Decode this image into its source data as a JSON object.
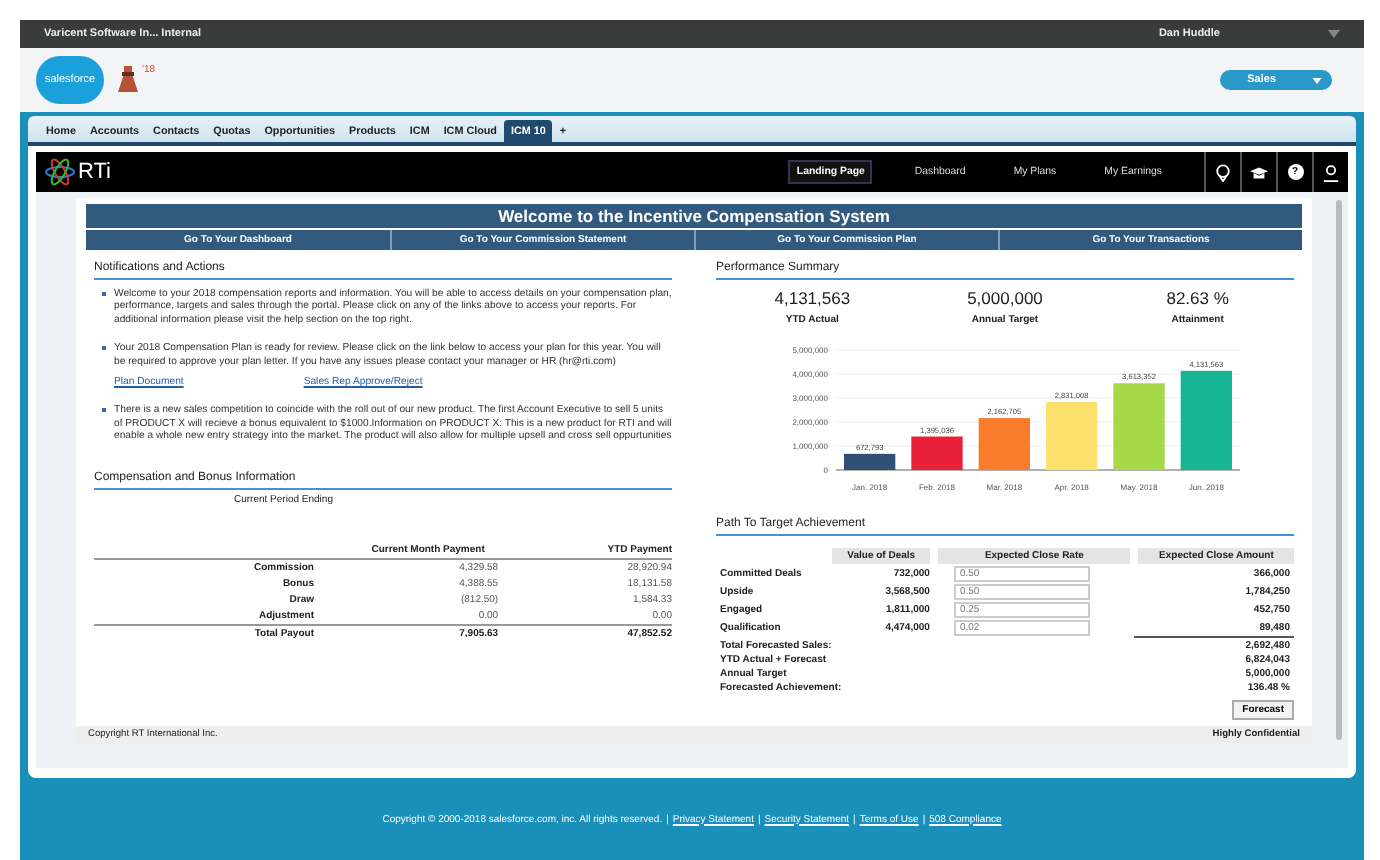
{
  "top_bar": {
    "org": "Varicent Software In... Internal",
    "user": "Dan Huddle"
  },
  "header": {
    "logo": "salesforce",
    "badge": "'18",
    "app_menu": "Sales"
  },
  "tabs": [
    {
      "label": "Home",
      "selected": false
    },
    {
      "label": "Accounts",
      "selected": false
    },
    {
      "label": "Contacts",
      "selected": false
    },
    {
      "label": "Quotas",
      "selected": false
    },
    {
      "label": "Opportunities",
      "selected": false
    },
    {
      "label": "Products",
      "selected": false
    },
    {
      "label": "ICM",
      "selected": false
    },
    {
      "label": "ICM Cloud",
      "selected": false
    },
    {
      "label": "ICM 10",
      "selected": true
    },
    {
      "label": "+",
      "selected": false
    }
  ],
  "app_nav": {
    "logo": "RTi",
    "items": [
      {
        "label": "Landing Page",
        "selected": true
      },
      {
        "label": "Dashboard",
        "selected": false
      },
      {
        "label": "My Plans",
        "selected": false
      },
      {
        "label": "My Earnings",
        "selected": false
      }
    ],
    "help": "?"
  },
  "banner": {
    "title": "Welcome to the Incentive Compensation System",
    "links": [
      "Go To Your Dashboard",
      "Go To Your Commission Statement",
      "Go To Your Commission Plan",
      "Go To Your Transactions"
    ]
  },
  "notifications": {
    "title": "Notifications and Actions",
    "items": [
      {
        "text": "Welcome to your 2018 compensation reports and information. You will be able to access details on your compensation plan, performance, targets and sales through the portal. Please click on any of the links above to access your reports. For additional information please visit the help section on the top right."
      },
      {
        "text": "Your 2018 Compensation Plan is ready for review. Please click on the link below to access your plan for this year. You will be required to approve your plan letter. If you have any issues please contact your manager or HR (hr@rti.com)",
        "links": [
          "Plan Document",
          "Sales Rep Approve/Reject"
        ]
      },
      {
        "text": "There is a new sales competition to coincide with the roll out of our new product. The first Account Executive to sell 5 units of PRODUCT X will recieve a bonus equivalent to $1000.Information on PRODUCT X: This is a new product for RTI and will enable a whole new entry strategy into the market. The product will also allow for multiple upsell and cross sell oppurtunities"
      }
    ]
  },
  "compensation": {
    "title": "Compensation and Bonus Information",
    "subtitle": "Current Period Ending",
    "columns": [
      "Current Month Payment",
      "YTD Payment"
    ],
    "rows": [
      {
        "kind": "line",
        "label": "Commission",
        "current": "4,329.58",
        "ytd": "28,920.94"
      },
      {
        "kind": "line",
        "label": "Bonus",
        "current": "4,388.55",
        "ytd": "18,131.58"
      },
      {
        "kind": "line",
        "label": "Draw",
        "current": "(812.50)",
        "ytd": "1,584.33"
      },
      {
        "kind": "line",
        "label": "Adjustment",
        "current": "0.00",
        "ytd": "0.00"
      },
      {
        "kind": "total",
        "label": "Total Payout",
        "current": "7,905.63",
        "ytd": "47,852.52"
      }
    ]
  },
  "performance": {
    "title": "Performance Summary",
    "kpis": [
      {
        "value": "4,131,563",
        "label": "YTD Actual"
      },
      {
        "value": "5,000,000",
        "label": "Annual Target"
      },
      {
        "value": "82.63 %",
        "label": "Attainment"
      }
    ],
    "chart_data": {
      "type": "bar",
      "categories": [
        "Jan. 2018",
        "Feb. 2018",
        "Mar. 2018",
        "Apr. 2018",
        "May. 2018",
        "Jun. 2018"
      ],
      "values": [
        672793,
        1395036,
        2162705,
        2831008,
        3613352,
        4131563
      ],
      "colors": [
        "#2f4f73",
        "#e8203a",
        "#f97b2c",
        "#fde16d",
        "#a6d84a",
        "#17b594"
      ],
      "value_labels": [
        "672,793",
        "1,395,036",
        "2,162,705",
        "2,831,008",
        "3,613,352",
        "4,131,563"
      ],
      "ylim": [
        0,
        5000000
      ],
      "grid": true,
      "yticks": [
        {
          "value": 0,
          "label": "0"
        },
        {
          "value": 1000000,
          "label": "1,000,000"
        },
        {
          "value": 2000000,
          "label": "2,000,000"
        },
        {
          "value": 3000000,
          "label": "3,000,000"
        },
        {
          "value": 4000000,
          "label": "4,000,000"
        },
        {
          "value": 5000000,
          "label": "5,000,000"
        }
      ]
    }
  },
  "path": {
    "title": "Path To Target Achievement",
    "columns": [
      "Value of Deals",
      "Expected Close Rate",
      "Expected Close Amount"
    ],
    "deals": [
      {
        "label": "Committed Deals",
        "value": "732,000",
        "rate": "0.50",
        "amount": "366,000"
      },
      {
        "label": "Upside",
        "value": "3,568,500",
        "rate": "0.50",
        "amount": "1,784,250"
      },
      {
        "label": "Engaged",
        "value": "1,811,000",
        "rate": "0.25",
        "amount": "452,750"
      },
      {
        "label": "Qualification",
        "value": "4,474,000",
        "rate": "0.02",
        "amount": "89,480"
      }
    ],
    "summary": [
      {
        "label": "Total Forecasted Sales:",
        "amount": "2,692,480"
      },
      {
        "label": "YTD Actual + Forecast",
        "amount": "6,824,043"
      },
      {
        "label": "Annual Target",
        "amount": "5,000,000"
      },
      {
        "label": "Forecasted Achievement:",
        "amount": "136.48 %"
      }
    ],
    "button": "Forecast"
  },
  "page_footer": {
    "left": "Copyright RT International Inc.",
    "right": "Highly Confidential"
  },
  "site_footer": [
    {
      "kind": "text",
      "text": "Copyright © 2000-2018 salesforce.com, inc. All rights reserved."
    },
    {
      "kind": "sep",
      "text": "|"
    },
    {
      "kind": "link",
      "text": "Privacy Statement"
    },
    {
      "kind": "sep",
      "text": "|"
    },
    {
      "kind": "link",
      "text": "Security Statement"
    },
    {
      "kind": "sep",
      "text": "|"
    },
    {
      "kind": "link",
      "text": "Terms of Use"
    },
    {
      "kind": "sep",
      "text": "|"
    },
    {
      "kind": "link",
      "text": "508 Compliance"
    }
  ]
}
